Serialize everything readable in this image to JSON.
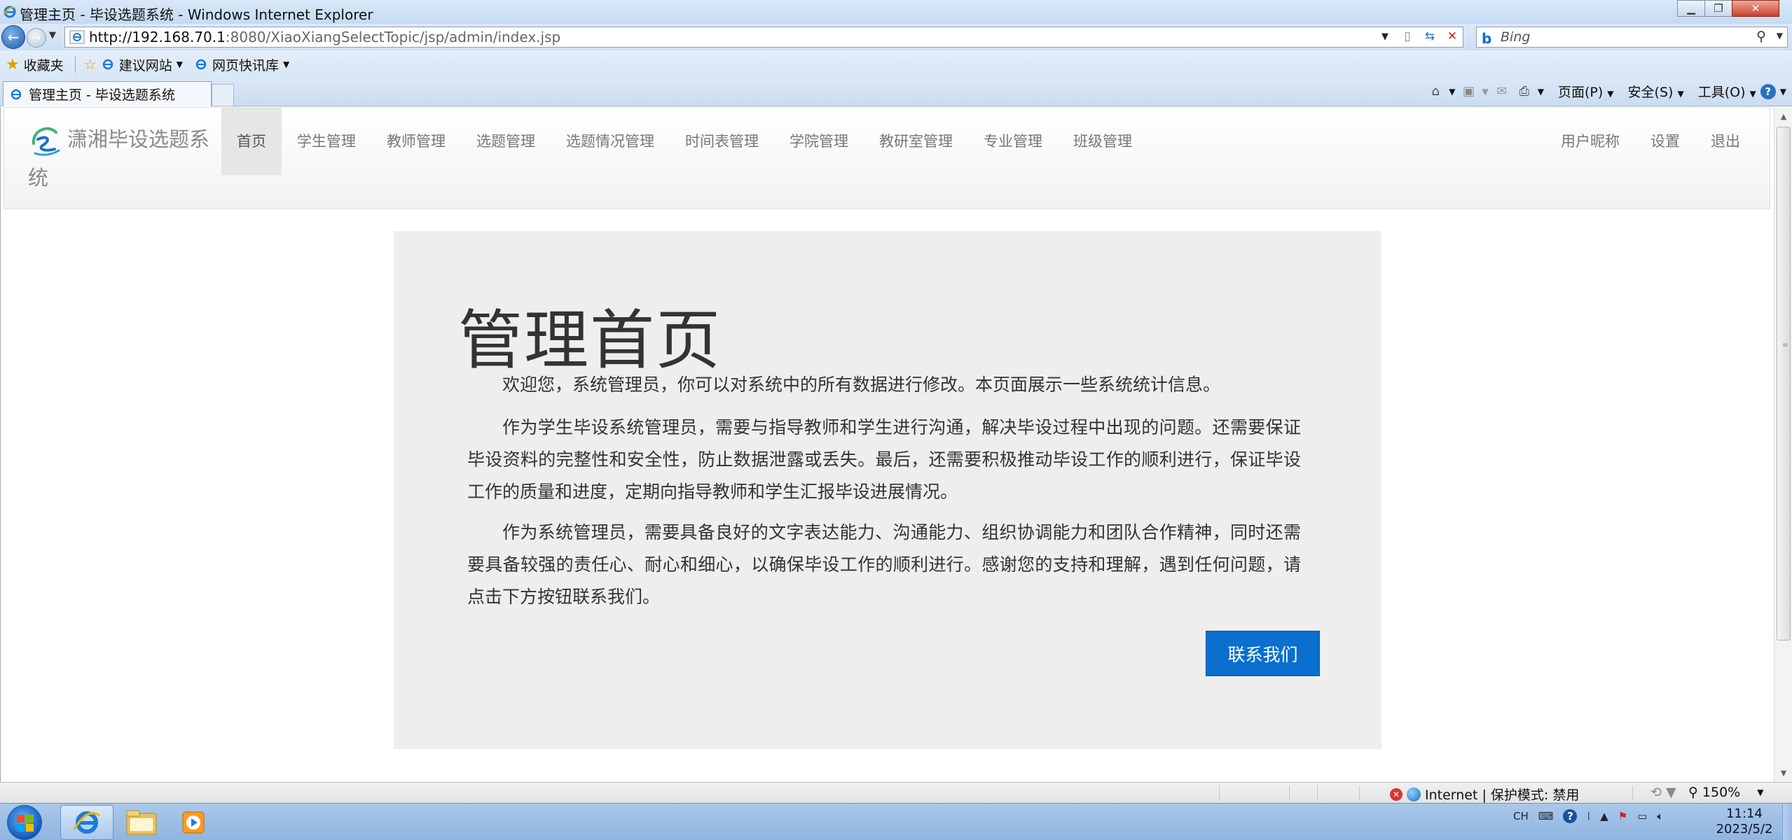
{
  "window": {
    "title": "管理主页 - 毕设选题系统 - Windows Internet Explorer",
    "minimize_glyph": "▁",
    "maximize_glyph": "❐",
    "close_glyph": "✕"
  },
  "address_bar": {
    "url_host": "http://192.168.70.1",
    "url_rest": ":8080/XiaoXiangSelectTopic/jsp/admin/index.jsp",
    "search_placeholder": "Bing"
  },
  "favorites_bar": {
    "favorites_label": "收藏夹",
    "items": [
      {
        "label": "建议网站",
        "icon": "ie-page-icon"
      },
      {
        "label": "网页快讯库",
        "icon": "ie-page-icon"
      }
    ]
  },
  "tab": {
    "label": "管理主页 - 毕设选题系统"
  },
  "command_bar": {
    "page_label": "页面(P)",
    "safety_label": "安全(S)",
    "tools_label": "工具(O)"
  },
  "site": {
    "brand": "潇湘毕设选题系统",
    "nav": [
      {
        "label": "首页",
        "active": true
      },
      {
        "label": "学生管理"
      },
      {
        "label": "教师管理"
      },
      {
        "label": "选题管理"
      },
      {
        "label": "选题情况管理"
      },
      {
        "label": "时间表管理"
      },
      {
        "label": "学院管理"
      },
      {
        "label": "教研室管理"
      },
      {
        "label": "专业管理"
      },
      {
        "label": "班级管理"
      }
    ],
    "nav_right": [
      {
        "label": "用户昵称"
      },
      {
        "label": "设置"
      },
      {
        "label": "退出"
      }
    ]
  },
  "main": {
    "heading": "管理首页",
    "paragraphs": [
      "欢迎您，系统管理员，你可以对系统中的所有数据进行修改。本页面展示一些系统统计信息。",
      "作为学生毕设系统管理员，需要与指导教师和学生进行沟通，解决毕设过程中出现的问题。还需要保证毕设资料的完整性和安全性，防止数据泄露或丢失。最后，还需要积极推动毕设工作的顺利进行，保证毕设工作的质量和进度，定期向指导教师和学生汇报毕设进展情况。",
      "作为系统管理员，需要具备良好的文字表达能力、沟通能力、组织协调能力和团队合作精神，同时还需要具备较强的责任心、耐心和细心，以确保毕设工作的顺利进行。感谢您的支持和理解，遇到任何问题，请点击下方按钮联系我们。"
    ],
    "contact_button": "联系我们"
  },
  "status_bar": {
    "zone": "Internet | 保护模式: 禁用",
    "zoom": "150%"
  },
  "taskbar": {
    "lang": "CH",
    "time": "11:14",
    "date": "2023/5/2"
  },
  "colors": {
    "accent": "#0a6fce",
    "jumbotron_bg": "#eeeeee",
    "navbar_active_bg": "#e6e6e6"
  }
}
